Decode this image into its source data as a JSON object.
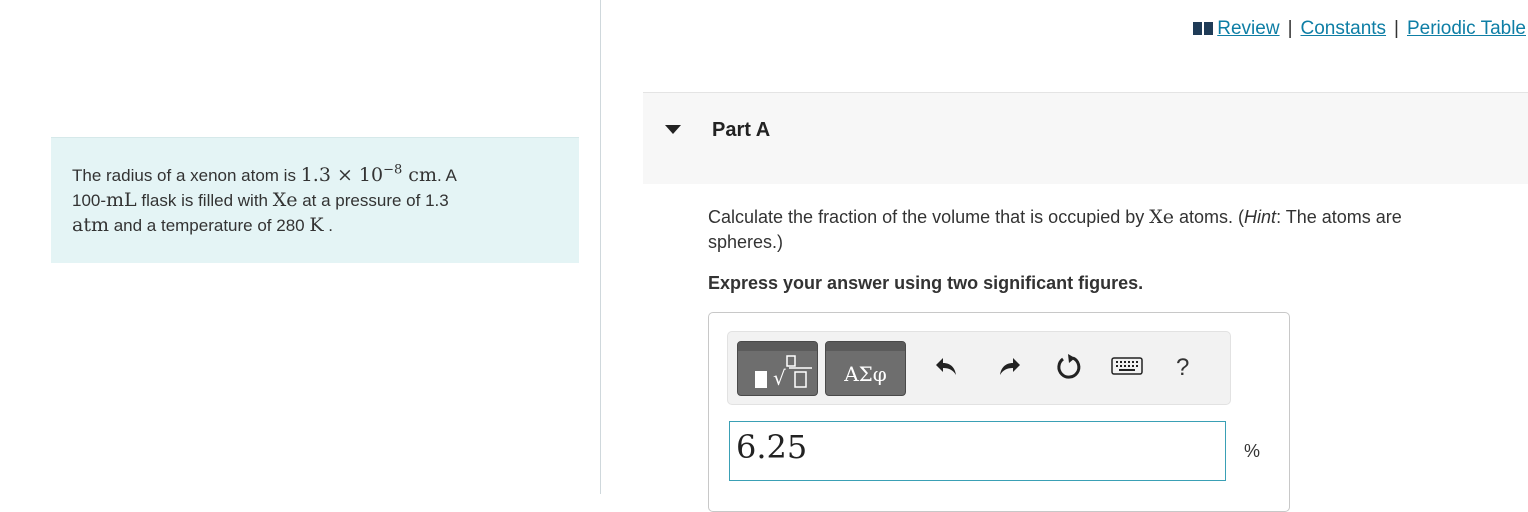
{
  "header_links": {
    "review": "Review",
    "separator": "|",
    "constants": "Constants",
    "periodic_table": "Periodic Table"
  },
  "problem": {
    "t1": "The radius of a xenon atom is ",
    "radius_coeff": "1.3 × 10",
    "radius_exp": "−8",
    "radius_unit": " cm",
    "t2": ". A",
    "t3": "100-",
    "vol_unit": "mL",
    "t4": " flask is filled with ",
    "gas": "Xe",
    "t5": " at a pressure of 1.3",
    "pressure_unit": "atm",
    "t6": " and a temperature of 280 ",
    "temp_unit": "K",
    "t7": " ."
  },
  "part": {
    "title": "Part A",
    "question_pre": "Calculate the fraction of the volume that is occupied by ",
    "question_gas": "Xe",
    "question_post": " atoms. (",
    "hint_label": "Hint",
    "hint_text": ": The atoms are",
    "question_line2": "spheres.)",
    "instruction": "Express your answer using two significant figures."
  },
  "toolbar": {
    "symbols_label": "ΑΣφ",
    "help_label": "?",
    "icons": [
      "templates-icon",
      "undo-icon",
      "redo-icon",
      "reset-icon",
      "keyboard-icon",
      "help-icon"
    ]
  },
  "answer": {
    "value": "6.25",
    "unit": "%"
  },
  "colors": {
    "link": "#0e7ea5",
    "problem_bg": "#e4f4f5",
    "input_border": "#3aa0b5"
  }
}
